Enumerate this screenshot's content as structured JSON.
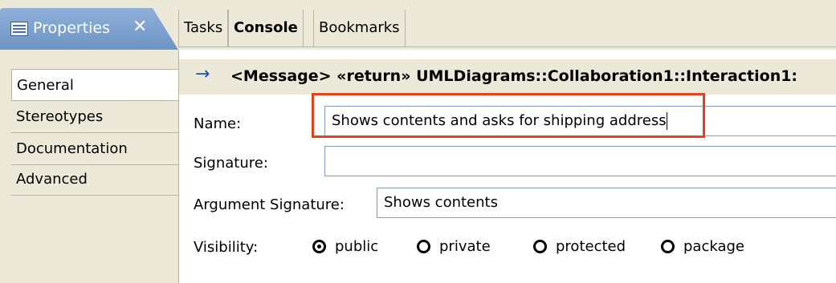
{
  "tabs": {
    "properties": "Properties",
    "tasks": "Tasks",
    "console": "Console",
    "bookmarks": "Bookmarks",
    "close_glyph": "✕"
  },
  "categories": [
    "General",
    "Stereotypes",
    "Documentation",
    "Advanced"
  ],
  "header": {
    "arrow": "→",
    "title": "<Message> «return» UMLDiagrams::Collaboration1::Interaction1:"
  },
  "form": {
    "name_label": "Name:",
    "name_value": "Shows contents and asks for shipping address",
    "signature_label": "Signature:",
    "signature_value": "",
    "argument_signature_label": "Argument Signature:",
    "argument_signature_value": "Shows contents",
    "visibility_label": "Visibility:",
    "visibility_options": [
      "public",
      "private",
      "protected",
      "package"
    ],
    "visibility_selected": "public"
  },
  "colors": {
    "active_tab": "#7aa0cf",
    "highlight": "#e2421c",
    "panel_bg": "#ece9d8"
  },
  "icons": {
    "properties_tab": "properties-view-icon",
    "arrow": "message-arrow-icon"
  }
}
